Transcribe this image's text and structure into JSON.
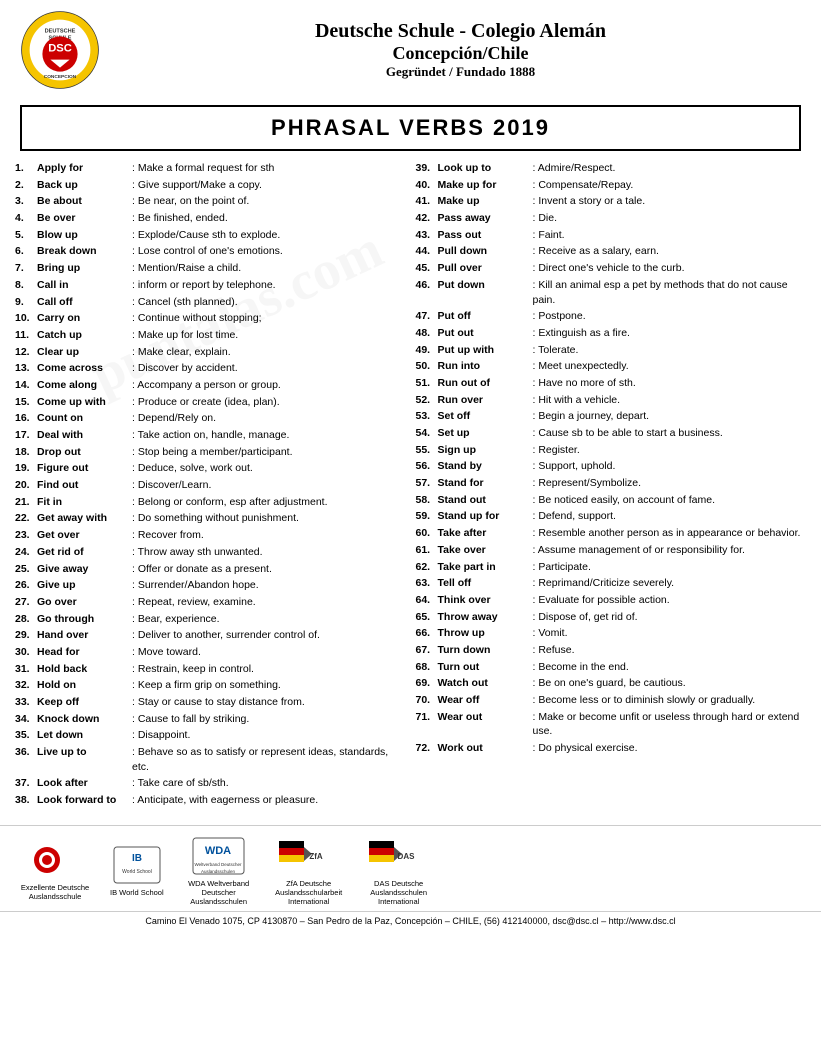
{
  "header": {
    "school_line1": "Deutsche Schule - Colegio Alemán",
    "school_line2": "Concepción/Chile",
    "school_line3": "Gegründet / Fundado 1888"
  },
  "title": "PHRASAL VERBS 2019",
  "left_verbs": [
    {
      "num": "1.",
      "phrase": "Apply for",
      "def": ": Make a formal request for sth"
    },
    {
      "num": "2.",
      "phrase": "Back up",
      "def": ": Give support/Make a copy."
    },
    {
      "num": "3.",
      "phrase": "Be about",
      "def": ": Be near, on the point of."
    },
    {
      "num": "4.",
      "phrase": "Be over",
      "def": ": Be finished, ended."
    },
    {
      "num": "5.",
      "phrase": "Blow up",
      "def": ": Explode/Cause sth to explode."
    },
    {
      "num": "6.",
      "phrase": "Break down",
      "def": ": Lose control of one's emotions."
    },
    {
      "num": "7.",
      "phrase": "Bring up",
      "def": ": Mention/Raise a child."
    },
    {
      "num": "8.",
      "phrase": "Call in",
      "def": ": inform or report by telephone."
    },
    {
      "num": "9.",
      "phrase": "Call off",
      "def": ": Cancel (sth planned)."
    },
    {
      "num": "10.",
      "phrase": "Carry on",
      "def": ": Continue without stopping;"
    },
    {
      "num": "11.",
      "phrase": "Catch up",
      "def": ": Make up for lost time."
    },
    {
      "num": "12.",
      "phrase": "Clear up",
      "def": ": Make clear, explain."
    },
    {
      "num": "13.",
      "phrase": "Come across",
      "def": ": Discover by accident."
    },
    {
      "num": "14.",
      "phrase": "Come along",
      "def": ": Accompany a person or group."
    },
    {
      "num": "15.",
      "phrase": "Come up with",
      "def": ": Produce or create (idea, plan)."
    },
    {
      "num": "16.",
      "phrase": "Count on",
      "def": ": Depend/Rely on."
    },
    {
      "num": "17.",
      "phrase": "Deal with",
      "def": ": Take action on, handle, manage."
    },
    {
      "num": "18.",
      "phrase": "Drop out",
      "def": ": Stop being a member/participant."
    },
    {
      "num": "19.",
      "phrase": "Figure out",
      "def": ": Deduce, solve, work out."
    },
    {
      "num": "20.",
      "phrase": "Find out",
      "def": ": Discover/Learn."
    },
    {
      "num": "21.",
      "phrase": "Fit in",
      "def": ": Belong or conform, esp after adjustment."
    },
    {
      "num": "22.",
      "phrase": "Get away with",
      "def": ": Do something without punishment."
    },
    {
      "num": "23.",
      "phrase": "Get over",
      "def": ": Recover from."
    },
    {
      "num": "24.",
      "phrase": "Get rid of",
      "def": ": Throw away sth unwanted."
    },
    {
      "num": "25.",
      "phrase": "Give away",
      "def": ": Offer or donate as a present."
    },
    {
      "num": "26.",
      "phrase": "Give up",
      "def": ": Surrender/Abandon hope."
    },
    {
      "num": "27.",
      "phrase": "Go over",
      "def": ": Repeat, review, examine."
    },
    {
      "num": "28.",
      "phrase": "Go through",
      "def": ": Bear, experience."
    },
    {
      "num": "29.",
      "phrase": "Hand over",
      "def": ": Deliver to another, surrender control of."
    },
    {
      "num": "30.",
      "phrase": "Head for",
      "def": ": Move toward."
    },
    {
      "num": "31.",
      "phrase": "Hold back",
      "def": ": Restrain, keep in control."
    },
    {
      "num": "32.",
      "phrase": "Hold on",
      "def": ": Keep a firm grip on something."
    },
    {
      "num": "33.",
      "phrase": "Keep off",
      "def": ": Stay or cause to stay distance from."
    },
    {
      "num": "34.",
      "phrase": "Knock down",
      "def": ": Cause to fall by striking."
    },
    {
      "num": "35.",
      "phrase": "Let down",
      "def": ": Disappoint."
    },
    {
      "num": "36.",
      "phrase": "Live up to",
      "def": ": Behave so as to satisfy or represent ideas, standards, etc."
    },
    {
      "num": "37.",
      "phrase": "Look after",
      "def": ": Take care of sb/sth."
    },
    {
      "num": "38.",
      "phrase": "Look forward to",
      "def": ": Anticipate, with eagerness or pleasure."
    }
  ],
  "right_verbs": [
    {
      "num": "39.",
      "phrase": "Look up to",
      "def": ": Admire/Respect."
    },
    {
      "num": "40.",
      "phrase": "Make up for",
      "def": ": Compensate/Repay."
    },
    {
      "num": "41.",
      "phrase": "Make up",
      "def": ": Invent a story or a tale."
    },
    {
      "num": "42.",
      "phrase": "Pass away",
      "def": ": Die."
    },
    {
      "num": "43.",
      "phrase": "Pass out",
      "def": ": Faint."
    },
    {
      "num": "44.",
      "phrase": "Pull down",
      "def": ": Receive as a salary, earn."
    },
    {
      "num": "45.",
      "phrase": "Pull over",
      "def": ": Direct one's vehicle to the curb."
    },
    {
      "num": "46.",
      "phrase": "Put down",
      "def": ": Kill an animal esp a pet by methods that do not cause pain."
    },
    {
      "num": "47.",
      "phrase": "Put off",
      "def": ": Postpone."
    },
    {
      "num": "48.",
      "phrase": "Put out",
      "def": ": Extinguish as a fire."
    },
    {
      "num": "49.",
      "phrase": "Put up with",
      "def": ": Tolerate."
    },
    {
      "num": "50.",
      "phrase": "Run into",
      "def": ": Meet unexpectedly."
    },
    {
      "num": "51.",
      "phrase": "Run out of",
      "def": ": Have no more of sth."
    },
    {
      "num": "52.",
      "phrase": "Run over",
      "def": ": Hit with a vehicle."
    },
    {
      "num": "53.",
      "phrase": "Set off",
      "def": ": Begin a journey, depart."
    },
    {
      "num": "54.",
      "phrase": "Set up",
      "def": ": Cause sb to be able to start a business."
    },
    {
      "num": "55.",
      "phrase": "Sign up",
      "def": ": Register."
    },
    {
      "num": "56.",
      "phrase": "Stand by",
      "def": ": Support, uphold."
    },
    {
      "num": "57.",
      "phrase": "Stand for",
      "def": ": Represent/Symbolize."
    },
    {
      "num": "58.",
      "phrase": "Stand out",
      "def": ": Be noticed easily, on account of fame."
    },
    {
      "num": "59.",
      "phrase": "Stand up for",
      "def": ": Defend, support."
    },
    {
      "num": "60.",
      "phrase": "Take after",
      "def": ": Resemble another person as in appearance or behavior."
    },
    {
      "num": "61.",
      "phrase": "Take over",
      "def": ": Assume management of or responsibility for."
    },
    {
      "num": "62.",
      "phrase": "Take part in",
      "def": ": Participate."
    },
    {
      "num": "63.",
      "phrase": "Tell off",
      "def": ": Reprimand/Criticize severely."
    },
    {
      "num": "64.",
      "phrase": "Think over",
      "def": ": Evaluate for possible action."
    },
    {
      "num": "65.",
      "phrase": "Throw away",
      "def": ": Dispose of, get rid of."
    },
    {
      "num": "66.",
      "phrase": "Throw up",
      "def": ": Vomit."
    },
    {
      "num": "67.",
      "phrase": "Turn down",
      "def": ": Refuse."
    },
    {
      "num": "68.",
      "phrase": "Turn out",
      "def": ": Become in the end."
    },
    {
      "num": "69.",
      "phrase": "Watch out",
      "def": ": Be on one's guard, be cautious."
    },
    {
      "num": "70.",
      "phrase": "Wear off",
      "def": ": Become less or to diminish slowly or gradually."
    },
    {
      "num": "71.",
      "phrase": "Wear out",
      "def": ": Make or become unfit or useless through hard or extend use."
    },
    {
      "num": "72.",
      "phrase": "Work out",
      "def": ": Do physical exercise."
    }
  ],
  "footer": {
    "logos": [
      {
        "name": "Exzellente Deutsche Auslandsschule",
        "type": "red-circle"
      },
      {
        "name": "IB World School",
        "type": "ib"
      },
      {
        "name": "WDA Weltverband Deutscher Auslandsschulen",
        "type": "wda"
      },
      {
        "name": "ZfA Deutsche Auslandsschularbeit International",
        "type": "zfa"
      },
      {
        "name": "DAS Deutsche Auslandsschulen International",
        "type": "das"
      }
    ],
    "address": "Camino El Venado 1075, CP 4130870 – San Pedro de la Paz, Concepción – CHILE, (56) 412140000, dsc@dsc.cl – http://www.dsc.cl"
  }
}
